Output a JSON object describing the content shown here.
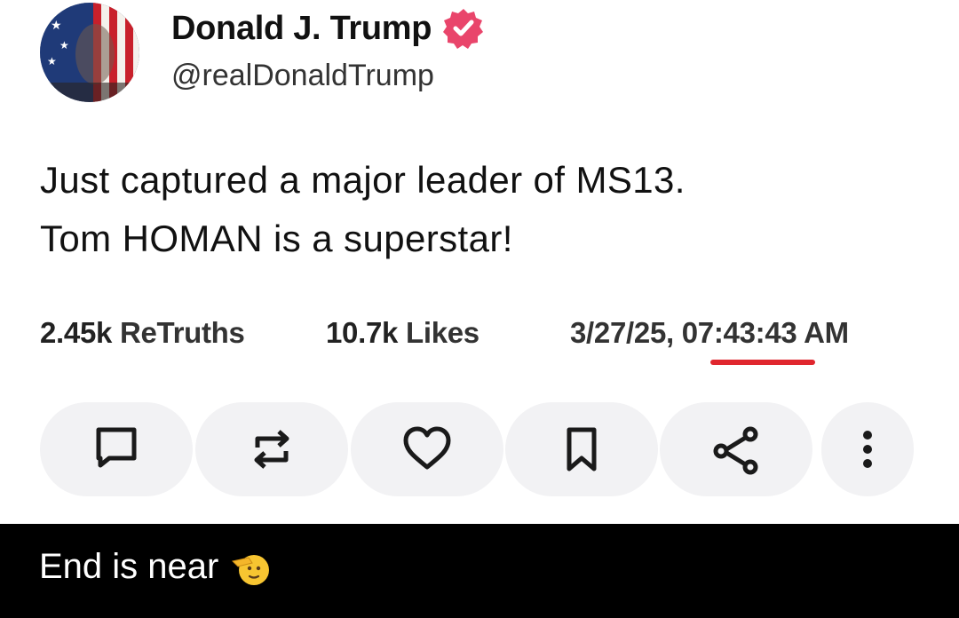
{
  "author": {
    "display_name": "Donald J. Trump",
    "handle": "@realDonaldTrump",
    "verified_icon": "verified-badge-icon"
  },
  "post": {
    "line1": "Just captured a major leader of MS13.",
    "line2": "Tom HOMAN is a superstar!"
  },
  "stats": {
    "retruths_count": "2.45k",
    "retruths_label": "ReTruths",
    "likes_count": "10.7k",
    "likes_label": "Likes",
    "timestamp": "3/27/25, 07:43:43 AM"
  },
  "actions": [
    {
      "name": "reply",
      "icon": "comment-icon"
    },
    {
      "name": "retruth",
      "icon": "repost-icon"
    },
    {
      "name": "like",
      "icon": "heart-icon"
    },
    {
      "name": "bookmark",
      "icon": "bookmark-icon"
    },
    {
      "name": "share",
      "icon": "share-icon"
    },
    {
      "name": "more",
      "icon": "more-vertical-icon"
    }
  ],
  "caption": {
    "text": "End is near",
    "emoji": "saluting-face-emoji"
  },
  "colors": {
    "verified_badge": "#e9456b",
    "annotation_underline": "#e0262e",
    "action_pill_bg": "#f2f2f4",
    "caption_bg": "#000000"
  }
}
